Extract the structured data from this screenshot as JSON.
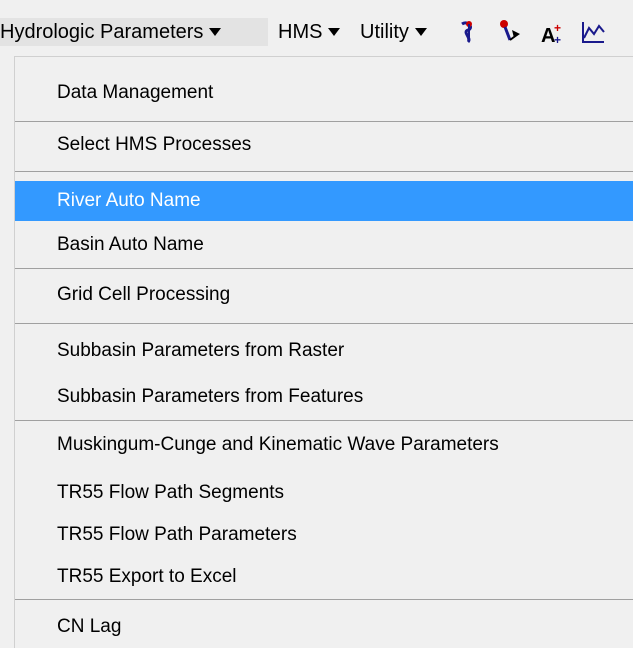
{
  "toolbar": {
    "menus": [
      {
        "label": "Hydrologic Parameters"
      },
      {
        "label": "HMS"
      },
      {
        "label": "Utility"
      }
    ],
    "icons": [
      "pin-flow-icon",
      "flow-arrow-icon",
      "label-add-icon",
      "profile-graph-icon"
    ]
  },
  "menu": {
    "items": [
      {
        "label": "Data Management"
      },
      {
        "label": "Select HMS Processes"
      },
      {
        "label": "River Auto Name",
        "selected": true
      },
      {
        "label": "Basin Auto Name"
      },
      {
        "label": "Grid Cell Processing"
      },
      {
        "label": "Subbasin Parameters from Raster"
      },
      {
        "label": "Subbasin Parameters from Features"
      },
      {
        "label": "Muskingum-Cunge and Kinematic Wave Parameters"
      },
      {
        "label": "TR55 Flow Path Segments"
      },
      {
        "label": "TR55 Flow Path Parameters"
      },
      {
        "label": "TR55 Export to Excel"
      },
      {
        "label": "CN Lag"
      }
    ]
  },
  "colors": {
    "selection": "#3399ff",
    "menu_background": "#f0f0f0",
    "separator": "#a0a0a0"
  }
}
